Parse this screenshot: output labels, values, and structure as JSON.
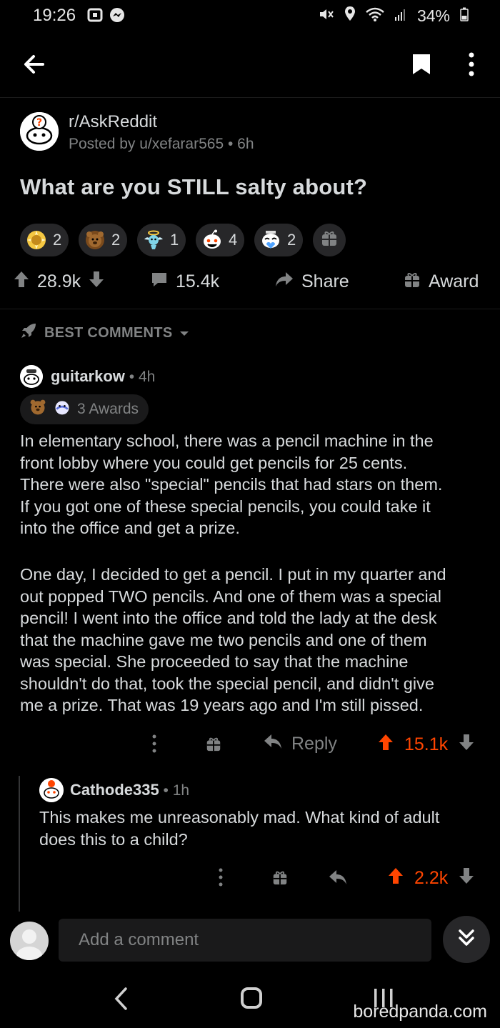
{
  "status_bar": {
    "time": "19:26",
    "battery": "34%"
  },
  "post": {
    "subreddit": "r/AskReddit",
    "posted_by": "Posted by u/xefarar565",
    "age": "6h",
    "title": "What are you STILL salty about?",
    "awards": [
      {
        "icon": "gold-award-icon",
        "count": "2",
        "color": "#f5c842"
      },
      {
        "icon": "bear-award-icon",
        "count": "2",
        "color": "#a0692f"
      },
      {
        "icon": "angel-award-icon",
        "count": "1",
        "color": "#7fd4e8"
      },
      {
        "icon": "snoo-award-icon",
        "count": "4",
        "color": "#ffffff"
      },
      {
        "icon": "wholesome-award-icon",
        "count": "2",
        "color": "#4fa3ff"
      }
    ],
    "upvotes": "28.9k",
    "comments": "15.4k",
    "share_label": "Share",
    "award_label": "Award"
  },
  "sort": {
    "label": "BEST COMMENTS"
  },
  "comments": [
    {
      "author": "guitarkow",
      "age": "4h",
      "awards_label": "3 Awards",
      "paragraphs": [
        [
          "In elementary school, there was a pencil machine in the",
          "front lobby where you could get pencils for 25 cents.",
          "There were also \"special\" pencils that had stars on them.",
          "If you got one of these special pencils, you could take it",
          "into the office and get a prize."
        ],
        [
          "One day, I decided to get a pencil. I put in my quarter and",
          "out popped TWO pencils. And one of them was a special",
          "pencil! I went into the office and told the lady at the desk",
          "that the machine gave me two pencils and one of them",
          "was special. She proceeded to say that the machine",
          "shouldn't do that, took the special pencil, and didn't give",
          "me a prize. That was 19 years ago and I'm still pissed."
        ]
      ],
      "reply_label": "Reply",
      "score": "15.1k"
    },
    {
      "author": "Cathode335",
      "age": "1h",
      "lines": [
        "This makes me unreasonably mad. What kind of adult",
        "does this to a child?"
      ],
      "score": "2.2k"
    }
  ],
  "composer": {
    "placeholder": "Add a comment"
  },
  "watermark": "boredpanda.com",
  "colors": {
    "accent": "#ff4500",
    "background": "#000000",
    "surface": "#1a1a1b",
    "muted": "#818384"
  }
}
